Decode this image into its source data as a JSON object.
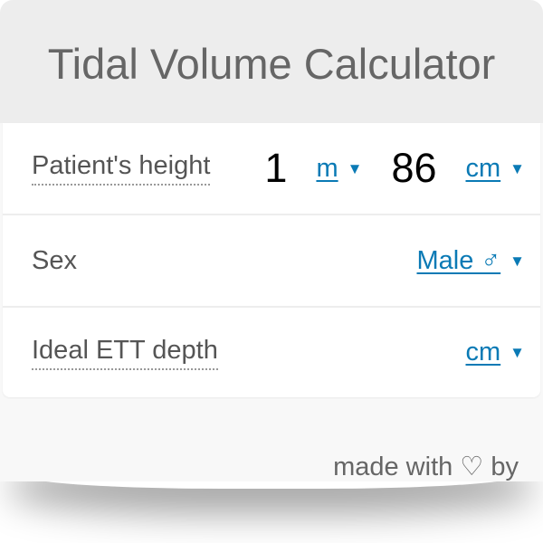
{
  "title": "Tidal Volume Calculator",
  "fields": [
    {
      "label": "Patient's height",
      "values": [
        {
          "value": "1",
          "unit": "m",
          "unit_arrow": "▼"
        },
        {
          "value": "86",
          "unit": "cm",
          "unit_arrow": "▼"
        }
      ]
    },
    {
      "label": "Sex",
      "selected": "Male ♂",
      "arrow": "▼"
    },
    {
      "label": "Ideal ETT depth",
      "unit": "cm",
      "arrow": "▼"
    }
  ],
  "footer": "made with ♡ by",
  "colors": {
    "accent": "#0a7ab5",
    "header_bg": "#ededed",
    "text": "#555555"
  }
}
